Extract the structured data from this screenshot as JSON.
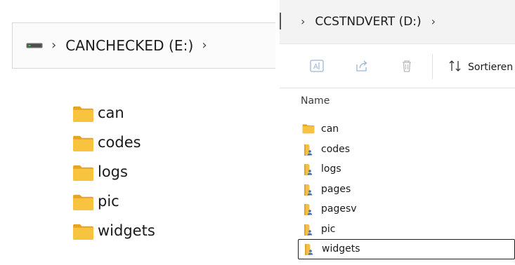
{
  "left_window": {
    "address": {
      "drive_icon": "drive-icon",
      "crumb": "CANCHECKED (E:)",
      "chevron": "›"
    },
    "items": [
      {
        "name": "can",
        "icon": "folder-icon"
      },
      {
        "name": "codes",
        "icon": "folder-icon"
      },
      {
        "name": "logs",
        "icon": "folder-icon"
      },
      {
        "name": "pic",
        "icon": "folder-icon"
      },
      {
        "name": "widgets",
        "icon": "folder-icon"
      }
    ]
  },
  "right_window": {
    "address": {
      "crumb": "CCSTNDVERT (D:)",
      "chevron": "›"
    },
    "toolbar": {
      "rename_icon": "rename-icon",
      "share_icon": "share-icon",
      "delete_icon": "delete-icon",
      "sort_label": "Sortieren"
    },
    "column_header": "Name",
    "items": [
      {
        "name": "can",
        "icon": "folder-icon"
      },
      {
        "name": "codes",
        "icon": "shared-folder-icon"
      },
      {
        "name": "logs",
        "icon": "shared-folder-icon"
      },
      {
        "name": "pages",
        "icon": "shared-folder-icon"
      },
      {
        "name": "pagesv",
        "icon": "shared-folder-icon"
      },
      {
        "name": "pic",
        "icon": "shared-folder-icon"
      },
      {
        "name": "widgets",
        "icon": "shared-folder-icon",
        "focused": true
      }
    ],
    "colors": {
      "folder_yellow": "#f8c440",
      "folder_dark": "#e5a523",
      "user_badge": "#4a6fa5"
    }
  }
}
